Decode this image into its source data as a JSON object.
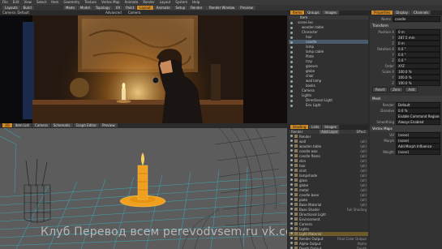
{
  "menu": {
    "items": [
      "File",
      "Edit",
      "View",
      "Select",
      "Item",
      "Geometry",
      "Texture",
      "Vertex Map",
      "Animate",
      "Render",
      "Layout",
      "System",
      "Help"
    ]
  },
  "toolbar": {
    "left": [
      "Layouts",
      "Build"
    ],
    "tabs": [
      "Modo",
      "Model",
      "Topology",
      "UV",
      "Paint",
      "Layout",
      "Animate",
      "Setup",
      "Render",
      "Games"
    ],
    "right": [
      "Render Window",
      "Preview"
    ]
  },
  "viewport_top": {
    "label": "Camera: Default",
    "options": [
      "Advanced",
      "Camera"
    ]
  },
  "viewport_bottom": {
    "tabs": [
      "3D",
      "Item List",
      "Camera",
      "Schematic",
      "Graph Editor",
      "Preview"
    ],
    "label": "Perspective"
  },
  "items_panel": {
    "tabs": [
      "Items",
      "Groups",
      "Images"
    ],
    "header": "Item",
    "items": [
      {
        "label": "scene.lxo",
        "indent": 0
      },
      {
        "label": "wooden table",
        "indent": 1
      },
      {
        "label": "Character",
        "indent": 1
      },
      {
        "label": "hair",
        "indent": 2
      },
      {
        "label": "candle",
        "indent": 2,
        "state": "sel"
      },
      {
        "label": "lamp",
        "indent": 2
      },
      {
        "label": "lamp cable",
        "indent": 2
      },
      {
        "label": "Plate",
        "indent": 2
      },
      {
        "label": "tray",
        "indent": 2
      },
      {
        "label": "glasses",
        "indent": 2
      },
      {
        "label": "globe",
        "indent": 2
      },
      {
        "label": "chair",
        "indent": 2
      },
      {
        "label": "wall lamp",
        "indent": 2
      },
      {
        "label": "books",
        "indent": 2
      },
      {
        "label": "Camera",
        "indent": 1
      },
      {
        "label": "Lights",
        "indent": 1
      },
      {
        "label": "Directional Light",
        "indent": 2
      },
      {
        "label": "Env Light",
        "indent": 2
      }
    ]
  },
  "properties_panel": {
    "tabs": [
      "Properties",
      "Display",
      "Channels"
    ],
    "item_name": "candle",
    "section_transform": "Transform",
    "fields": [
      {
        "label": "Position X",
        "value": "0 m"
      },
      {
        "label": "Y",
        "value": "287.5 mm"
      },
      {
        "label": "Z",
        "value": "0 m"
      },
      {
        "label": "Rotation X",
        "value": "0.0 °"
      },
      {
        "label": "Y",
        "value": "0.0 °"
      },
      {
        "label": "Z",
        "value": "0.0 °"
      },
      {
        "label": "Order",
        "value": "XYZ"
      },
      {
        "label": "Scale X",
        "value": "100.0 %"
      },
      {
        "label": "Y",
        "value": "100.0 %"
      },
      {
        "label": "Z",
        "value": "100.0 %"
      }
    ],
    "buttons": [
      "Reset",
      "Zero",
      "Add"
    ],
    "section_mesh": "Mesh",
    "mesh_fields": [
      {
        "label": "Render",
        "value": "Default"
      },
      {
        "label": "Dissolve",
        "value": "0.0 %"
      },
      {
        "label": "",
        "value": "Enable Command Regions"
      },
      {
        "label": "Smoothing",
        "value": "Always Enabled"
      }
    ],
    "section_vertex": "Vertex Maps",
    "vertex_fields": [
      {
        "label": "UV",
        "value": "(none)"
      },
      {
        "label": "Morph",
        "value": "(none)"
      },
      {
        "label": "",
        "value": "Add Morph Influence"
      },
      {
        "label": "Weight",
        "value": "(none)"
      }
    ]
  },
  "shader_panel": {
    "tabs": [
      "Shading",
      "Lists",
      "Images"
    ],
    "header_left": "Render",
    "header_right": "Effect",
    "add_button": "Add Layer",
    "items": [
      {
        "label": "Render",
        "effect": ""
      },
      {
        "label": "wall",
        "effect": "(all)"
      },
      {
        "label": "wooden table",
        "effect": "(all)"
      },
      {
        "label": "candle wax",
        "effect": "(all)"
      },
      {
        "label": "candle flame",
        "effect": "(all)"
      },
      {
        "label": "skin",
        "effect": "(all)"
      },
      {
        "label": "hair",
        "effect": "(all)"
      },
      {
        "label": "shirt",
        "effect": "(all)"
      },
      {
        "label": "lampshade",
        "effect": "(all)"
      },
      {
        "label": "glass",
        "effect": "(all)"
      },
      {
        "label": "globe",
        "effect": "(all)"
      },
      {
        "label": "metal",
        "effect": "(all)"
      },
      {
        "label": "candle base",
        "effect": "(all)"
      },
      {
        "label": "plate",
        "effect": "(all)"
      },
      {
        "label": "Base Material",
        "effect": "(all)"
      },
      {
        "label": "Base Shader",
        "effect": "Full Shading"
      },
      {
        "label": "Directional Light",
        "effect": ""
      },
      {
        "label": "Environment",
        "effect": ""
      },
      {
        "label": "Camera",
        "effect": ""
      },
      {
        "label": "Lights",
        "effect": ""
      },
      {
        "label": "Light Material",
        "effect": "",
        "state": "hl"
      },
      {
        "label": "Render Output",
        "effect": "Final Color Output"
      },
      {
        "label": "Alpha Output",
        "effect": "Alpha"
      },
      {
        "label": "Depth Output",
        "effect": "Depth"
      },
      {
        "label": "Environment",
        "effect": "Environment Color"
      }
    ]
  },
  "watermark": "Клуб Перевод всем  perevodvsem.ru  vk.com/perevodvsem",
  "colors": {
    "accent": "#d08a25",
    "wireframe": "#3aa6b4",
    "candle": "#f0a020"
  }
}
